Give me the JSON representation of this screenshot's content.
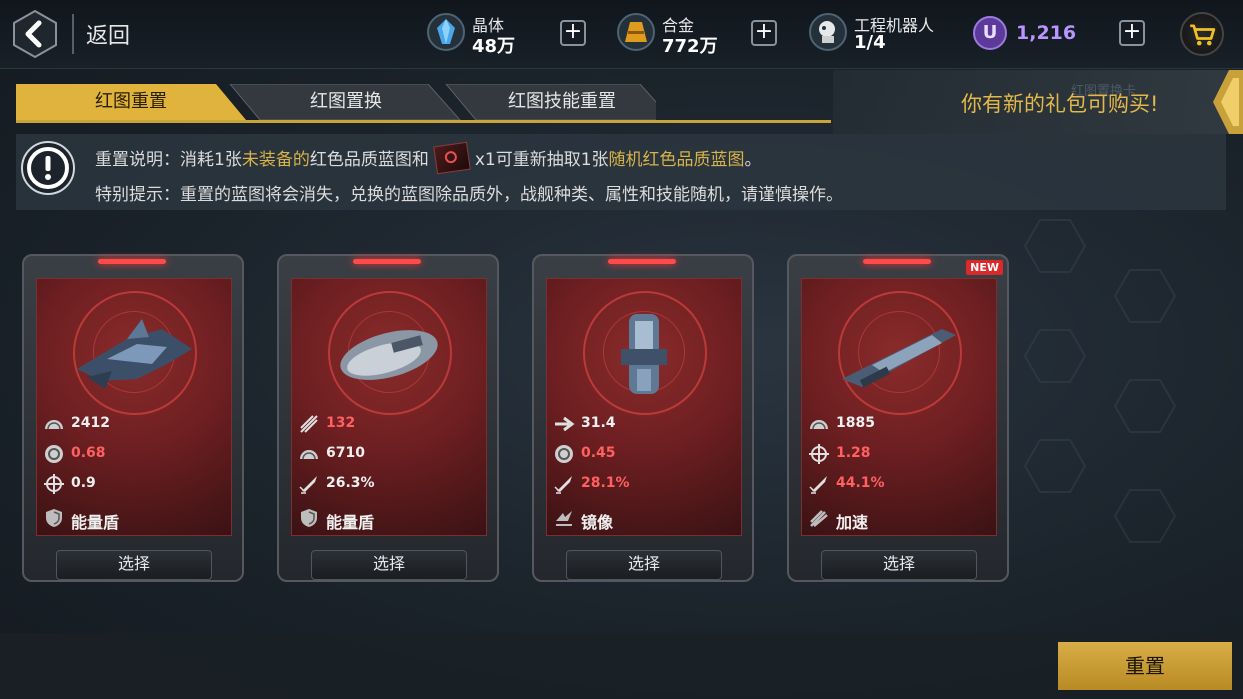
{
  "header": {
    "back_label": "返回",
    "resources": [
      {
        "name": "晶体",
        "value": "48万",
        "icon": "crystal-icon"
      },
      {
        "name": "合金",
        "value": "772万",
        "icon": "alloy-icon"
      },
      {
        "name": "工程机器人",
        "value": "1/4",
        "icon": "robot-icon"
      }
    ],
    "premium": {
      "symbol": "U",
      "value": "1,216"
    }
  },
  "tabs": [
    {
      "label": "红图重置",
      "active": true
    },
    {
      "label": "红图置换",
      "active": false
    },
    {
      "label": "红图技能重置",
      "active": false
    }
  ],
  "gift_banner": {
    "text": "你有新的礼包可购买!",
    "faint": "红图置换卡"
  },
  "info": {
    "l1_prefix": "重置说明：消耗1张",
    "l1_hl1": "未装备的",
    "l1_mid": "红色品质蓝图和",
    "l1_mid2": "x1可重新抽取1张",
    "l1_hl2": "随机红色品质蓝图",
    "l1_end": "。",
    "l2": "特别提示：重置的蓝图将会消失，兑换的蓝图除品质外，战舰种类、属性和技能随机，请谨慎操作。"
  },
  "cards": [
    {
      "new": false,
      "stats": [
        {
          "icon": "armor-icon",
          "value": "2412",
          "color": "white"
        },
        {
          "icon": "shield-rate-icon",
          "value": "0.68",
          "color": "red"
        },
        {
          "icon": "crosshair-icon",
          "value": "0.9",
          "color": "white"
        }
      ],
      "skill": {
        "icon": "shield-skill-icon",
        "label": "能量盾"
      },
      "select": "选择"
    },
    {
      "new": false,
      "stats": [
        {
          "icon": "attack-icon",
          "value": "132",
          "color": "red"
        },
        {
          "icon": "armor-icon",
          "value": "6710",
          "color": "white"
        },
        {
          "icon": "missile-icon",
          "value": "26.3%",
          "color": "white"
        }
      ],
      "skill": {
        "icon": "shield-skill-icon",
        "label": "能量盾"
      },
      "select": "选择"
    },
    {
      "new": false,
      "stats": [
        {
          "icon": "speed-icon",
          "value": "31.4",
          "color": "white"
        },
        {
          "icon": "shield-rate-icon",
          "value": "0.45",
          "color": "red"
        },
        {
          "icon": "missile-icon",
          "value": "28.1%",
          "color": "red"
        }
      ],
      "skill": {
        "icon": "mirror-skill-icon",
        "label": "镜像"
      },
      "select": "选择"
    },
    {
      "new": true,
      "new_label": "NEW",
      "stats": [
        {
          "icon": "armor-icon",
          "value": "1885",
          "color": "white"
        },
        {
          "icon": "crosshair-icon",
          "value": "1.28",
          "color": "red"
        },
        {
          "icon": "missile-icon",
          "value": "44.1%",
          "color": "red"
        }
      ],
      "skill": {
        "icon": "boost-skill-icon",
        "label": "加速"
      },
      "select": "选择"
    }
  ],
  "action": {
    "reset_label": "重置"
  }
}
